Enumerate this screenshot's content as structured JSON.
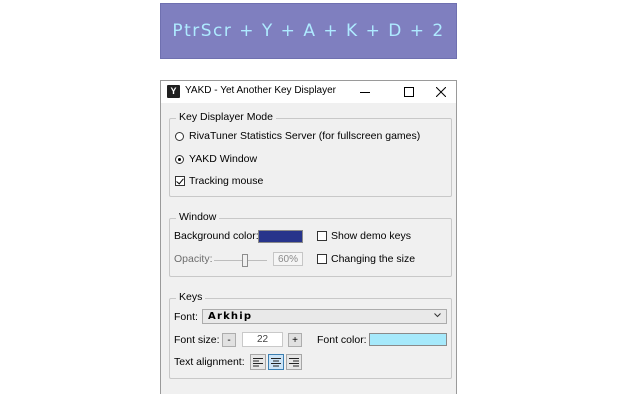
{
  "banner": {
    "text": "PtrScr + Y + A + K + D + 2",
    "background": "#7f7fbf",
    "text_color": "#aeeaff"
  },
  "window": {
    "title": "YAKD - Yet Another Key Displayer",
    "icon_letter": "Y",
    "caption_buttons": [
      "minimize-icon",
      "maximize-icon",
      "close-icon"
    ]
  },
  "mode": {
    "legend": "Key Displayer Mode",
    "option_rtss": "RivaTuner Statistics Server (for fullscreen games)",
    "option_window": "YAKD Window",
    "selected": "YAKD Window",
    "tracking_label": "Tracking mouse",
    "tracking_checked": true
  },
  "window_group": {
    "legend": "Window",
    "background_label": "Background color:",
    "background_color": "#27348b",
    "show_demo_label": "Show demo keys",
    "show_demo_checked": false,
    "opacity_label": "Opacity:",
    "opacity_value": "60%",
    "opacity_fraction": 0.6,
    "changing_size_label": "Changing the size",
    "changing_size_checked": false
  },
  "keys": {
    "legend": "Keys",
    "font_label": "Font:",
    "font_value": "Arkhip",
    "font_size_label": "Font size:",
    "font_size_minus": "-",
    "font_size_value": "22",
    "font_size_plus": "+",
    "font_color_label": "Font color:",
    "font_color": "#a6e9fb",
    "alignment_label": "Text alignment:",
    "alignment_options": [
      "align-left-icon",
      "align-center-icon",
      "align-right-icon"
    ],
    "alignment_selected": "align-center-icon"
  }
}
